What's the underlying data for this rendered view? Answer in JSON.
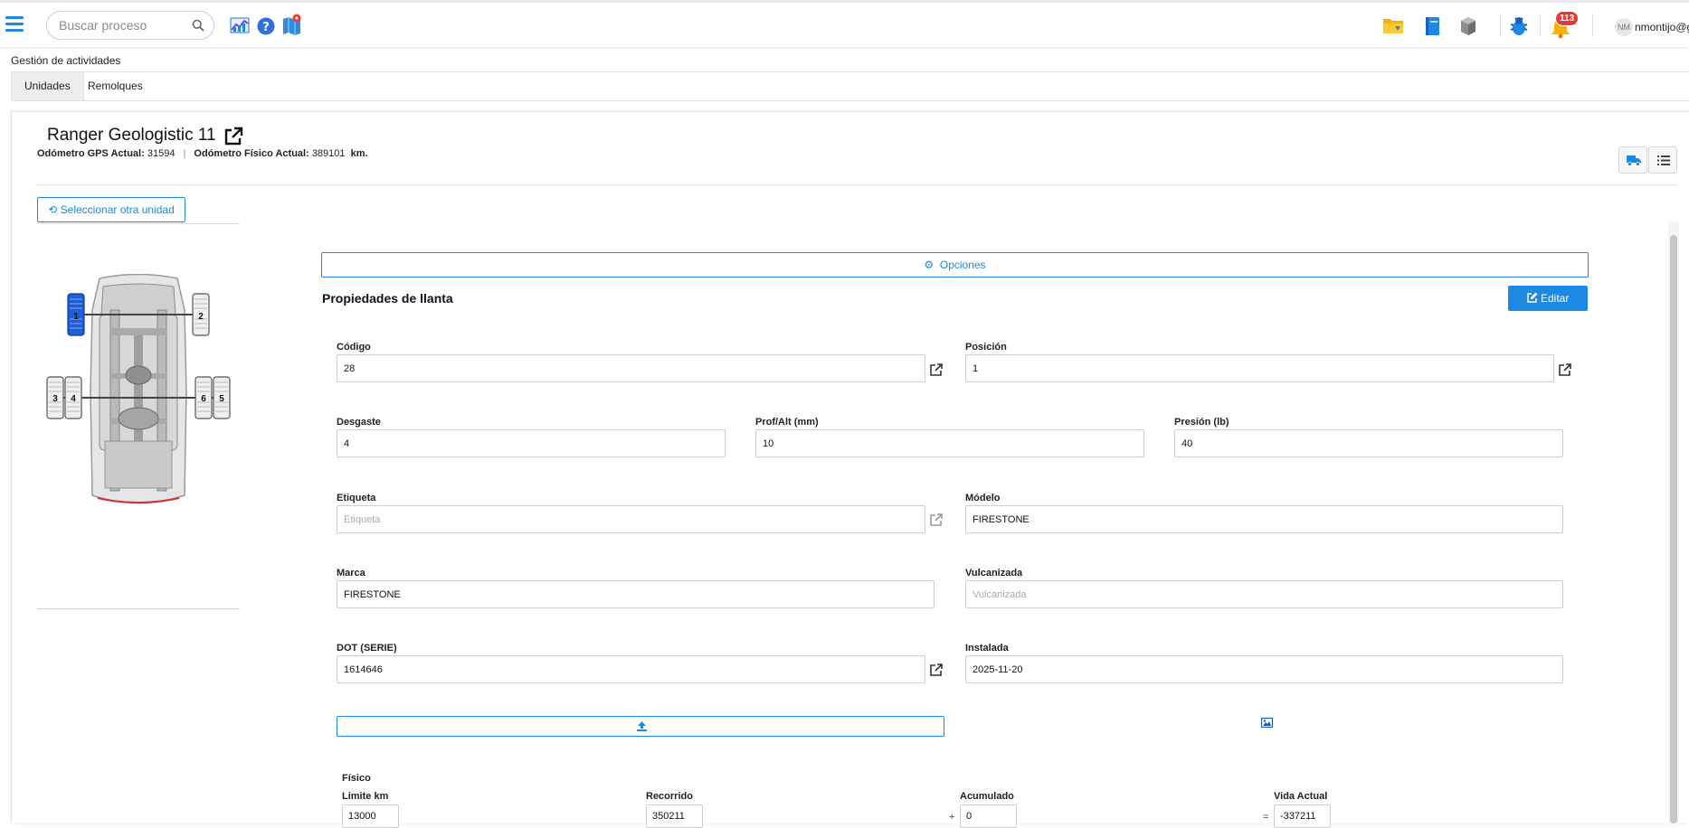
{
  "header": {
    "search_placeholder": "Buscar proceso",
    "notification_count": "113",
    "avatar_initials": "NM",
    "username": "nmontijo@g"
  },
  "breadcrumb": {
    "title": "Gestión de actividades"
  },
  "tabs": [
    {
      "label": "Unidades",
      "active": true
    },
    {
      "label": "Remolques",
      "active": false
    }
  ],
  "unit": {
    "name": "Ranger Geologistic 11",
    "odo_gps_label": "Odómetro GPS Actual:",
    "odo_gps_value": "31594",
    "odo_separator": "|",
    "odo_phys_label": "Odómetro Físico Actual:",
    "odo_phys_value": "389101",
    "odo_unit": "km."
  },
  "left_panel": {
    "select_other_label": "Seleccionar otra unidad",
    "tires": [
      "1",
      "2",
      "3",
      "4",
      "5",
      "6"
    ],
    "selected_tire": "1"
  },
  "form": {
    "options_label": "Opciones",
    "section_title": "Propiedades de llanta",
    "edit_label": "Editar",
    "fields": {
      "codigo": {
        "label": "Código",
        "value": "28"
      },
      "posicion": {
        "label": "Posición",
        "value": "1"
      },
      "desgaste": {
        "label": "Desgaste",
        "value": "4"
      },
      "prof": {
        "label": "Prof/Alt (mm)",
        "value": "10"
      },
      "presion": {
        "label": "Presión (lb)",
        "value": "40"
      },
      "etiqueta": {
        "label": "Etiqueta",
        "value": "",
        "placeholder": "Etiqueta"
      },
      "modelo": {
        "label": "Módelo",
        "value": "FIRESTONE"
      },
      "marca": {
        "label": "Marca",
        "value": "FIRESTONE"
      },
      "vulcanizada": {
        "label": "Vulcanizada",
        "value": "",
        "placeholder": "Vulcanizada"
      },
      "dot": {
        "label": "DOT (SERIE)",
        "value": "1614646"
      },
      "instalada": {
        "label": "Instalada",
        "value": "2025-11-20"
      }
    },
    "fisico": {
      "title": "Físico",
      "limite": {
        "label": "Limite km",
        "value": "13000"
      },
      "recorrido": {
        "label": "Recorrido",
        "value": "350211"
      },
      "acumulado": {
        "label": "Acumulado",
        "value": "0"
      },
      "vida": {
        "label": "Vida Actual",
        "value": "-337211"
      },
      "plus": "+",
      "equals": "="
    }
  },
  "colors": {
    "accent": "#1e88e5",
    "badge": "#e53935",
    "selected_tire": "#1e5fd8"
  },
  "icons": [
    "menu-icon",
    "search-icon",
    "chart-icon",
    "help-icon",
    "map-icon",
    "folder-icon",
    "book-icon",
    "box-icon",
    "bug-icon",
    "bell-icon",
    "external-link-icon",
    "truck-icon",
    "list-icon",
    "undo-icon",
    "gear-icon",
    "edit-icon",
    "upload-icon",
    "image-icon"
  ]
}
